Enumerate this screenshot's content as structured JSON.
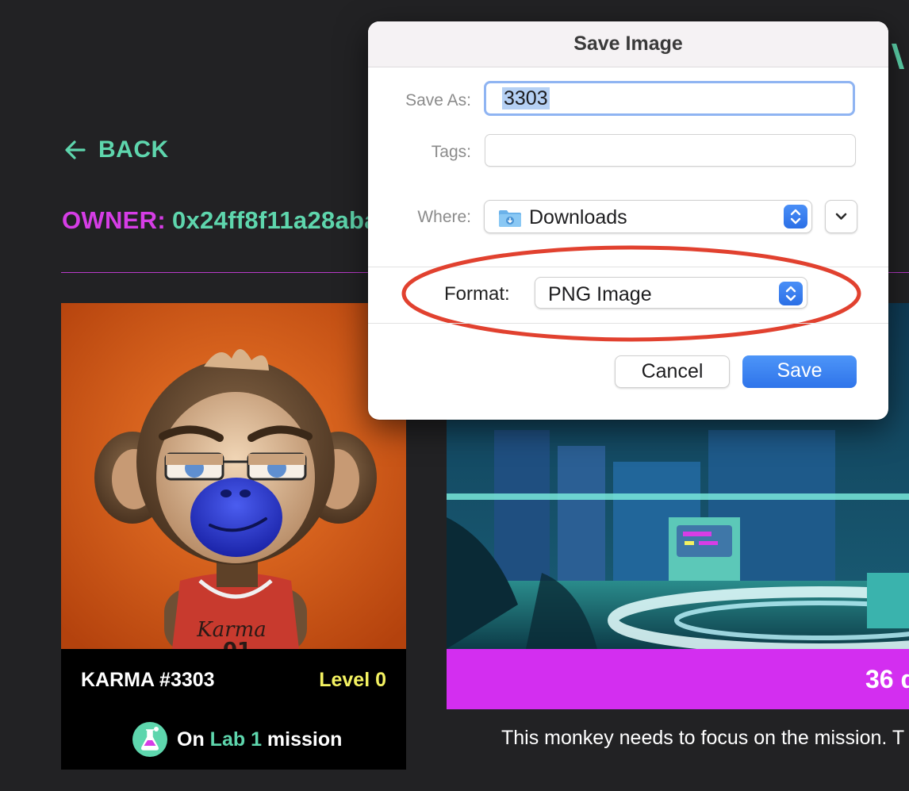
{
  "page": {
    "back_label": "BACK",
    "owner_label": "OWNER:",
    "owner_address": "0x24ff8f11a28aba",
    "card": {
      "title": "KARMA #3303",
      "level": "Level 0",
      "mission_prefix": "On",
      "mission_lab": "Lab 1",
      "mission_suffix": "mission",
      "jersey_text": "Karma",
      "jersey_number": "01"
    },
    "days_text": "36 d",
    "note": "This monkey needs to focus on the mission. T"
  },
  "dialog": {
    "title": "Save Image",
    "save_as_label": "Save As:",
    "save_as_value": "3303",
    "tags_label": "Tags:",
    "where_label": "Where:",
    "where_value": "Downloads",
    "format_label": "Format:",
    "format_value": "PNG Image",
    "cancel_label": "Cancel",
    "save_label": "Save"
  },
  "colors": {
    "teal": "#5ed6ad",
    "magenta": "#d63de6",
    "level_yellow": "#f4f261",
    "days_bar": "#d32ef0",
    "save_blue": "#2f74ea",
    "annotation_red": "#e1412f"
  }
}
